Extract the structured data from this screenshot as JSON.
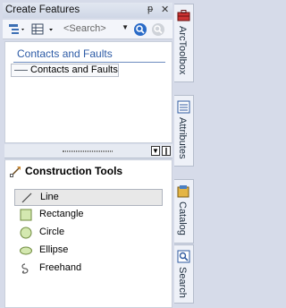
{
  "window": {
    "title": "Create Features",
    "pin_glyph": "ᵽ",
    "close_glyph": "✕"
  },
  "toolbar": {
    "search_placeholder": "<Search>"
  },
  "templates": {
    "group_title": "Contacts and Faults",
    "items": [
      {
        "label": "Contacts and Faults",
        "icon": "line-swatch"
      }
    ]
  },
  "construction_tools": {
    "title": "Construction Tools",
    "items": [
      {
        "label": "Line",
        "icon": "line-tool-icon",
        "selected": true
      },
      {
        "label": "Rectangle",
        "icon": "rectangle-tool-icon",
        "selected": false
      },
      {
        "label": "Circle",
        "icon": "circle-tool-icon",
        "selected": false
      },
      {
        "label": "Ellipse",
        "icon": "ellipse-tool-icon",
        "selected": false
      },
      {
        "label": "Freehand",
        "icon": "freehand-tool-icon",
        "selected": false
      }
    ]
  },
  "side_tabs": [
    {
      "label": "ArcToolbox",
      "icon": "toolbox-icon"
    },
    {
      "label": "Attributes",
      "icon": "attributes-icon"
    },
    {
      "label": "Catalog",
      "icon": "catalog-icon"
    },
    {
      "label": "Search",
      "icon": "search-window-icon"
    }
  ],
  "colors": {
    "group_title": "#2d5ba6",
    "shape_fill": "#d4e8b0",
    "shape_stroke": "#6e8a3d",
    "search_button": "#2a6bc7"
  }
}
